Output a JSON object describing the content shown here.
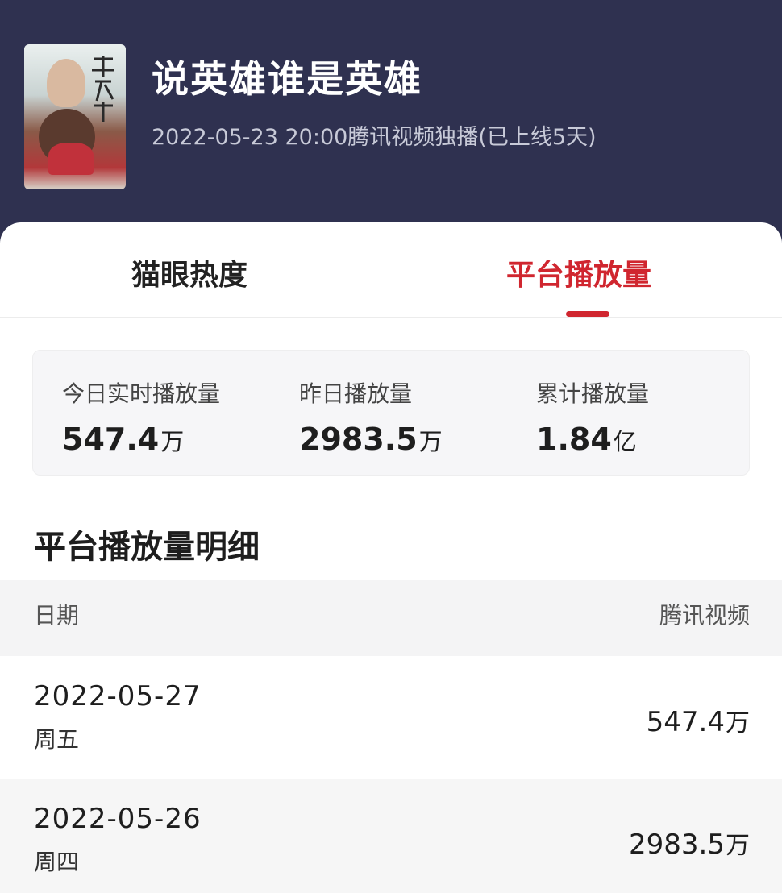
{
  "header": {
    "title": "说英雄谁是英雄",
    "subtitle": "2022-05-23 20:00腾讯视频独播(已上线5天)"
  },
  "tabs": [
    {
      "label": "猫眼热度",
      "active": false
    },
    {
      "label": "平台播放量",
      "active": true
    }
  ],
  "stats": [
    {
      "label": "今日实时播放量",
      "value": "547.4",
      "unit": "万"
    },
    {
      "label": "昨日播放量",
      "value": "2983.5",
      "unit": "万"
    },
    {
      "label": "累计播放量",
      "value": "1.84",
      "unit": "亿"
    }
  ],
  "detail": {
    "title": "平台播放量明细",
    "columns": [
      "日期",
      "腾讯视频"
    ],
    "rows": [
      {
        "date": "2022-05-27",
        "weekday": "周五",
        "value": "547.4",
        "unit": "万"
      },
      {
        "date": "2022-05-26",
        "weekday": "周四",
        "value": "2983.5",
        "unit": "万"
      }
    ]
  },
  "colors": {
    "header_bg": "#2f3150",
    "accent": "#d0262f"
  }
}
